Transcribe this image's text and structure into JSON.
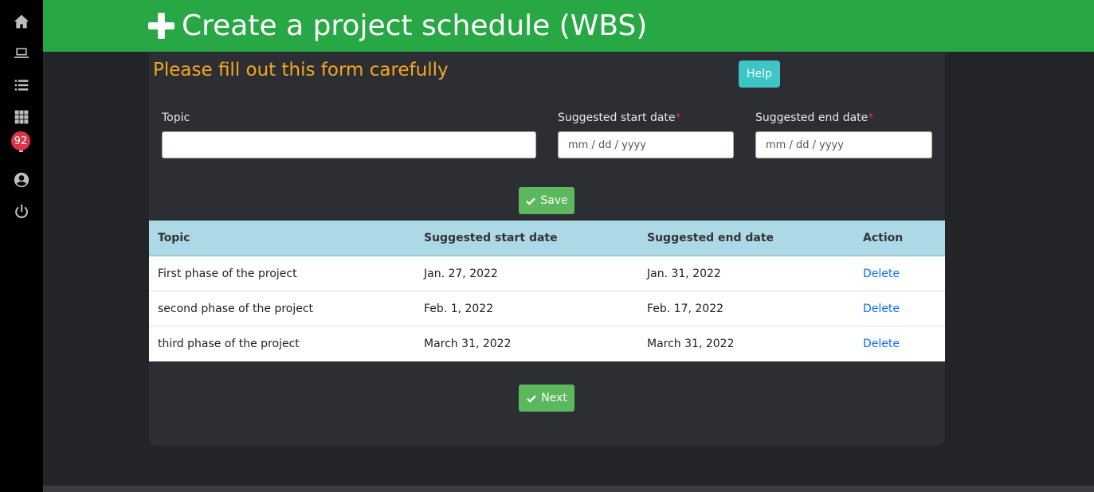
{
  "header": {
    "title": "Create a project schedule (WBS)",
    "icon": "plus-icon"
  },
  "sidebar": {
    "items": [
      {
        "icon": "home-icon"
      },
      {
        "icon": "laptop-icon"
      },
      {
        "icon": "list-icon"
      },
      {
        "icon": "grid-icon"
      },
      {
        "icon": "bell-icon",
        "badge": "92"
      },
      {
        "icon": "user-circle-icon"
      },
      {
        "icon": "power-icon"
      }
    ]
  },
  "form": {
    "heading": "Please fill out this form carefully",
    "help_label": "Help",
    "topic_label": "Topic",
    "topic_value": "",
    "start_label": "Suggested start date",
    "start_placeholder": "mm / dd / yyyy",
    "end_label": "Suggested end date",
    "end_placeholder": "mm / dd / yyyy",
    "required_mark": "*",
    "save_label": "Save"
  },
  "table": {
    "columns": [
      "Topic",
      "Suggested start date",
      "Suggested end date",
      "Action"
    ],
    "rows": [
      {
        "topic": "First phase of the project",
        "start": "Jan. 27, 2022",
        "end": "Jan. 31, 2022",
        "action": "Delete"
      },
      {
        "topic": "second phase of the project",
        "start": "Feb. 1, 2022",
        "end": "Feb. 17, 2022",
        "action": "Delete"
      },
      {
        "topic": "third phase of the project",
        "start": "March 31, 2022",
        "end": "March 31, 2022",
        "action": "Delete"
      }
    ]
  },
  "next_label": "Next",
  "colors": {
    "header_bg": "#28a745",
    "heading_orange": "#f5a623",
    "help_teal": "#3ec6c6",
    "button_green": "#5cb85c",
    "table_header": "#add8e6",
    "link_blue": "#0d6efd",
    "badge_red": "#dc3545"
  }
}
